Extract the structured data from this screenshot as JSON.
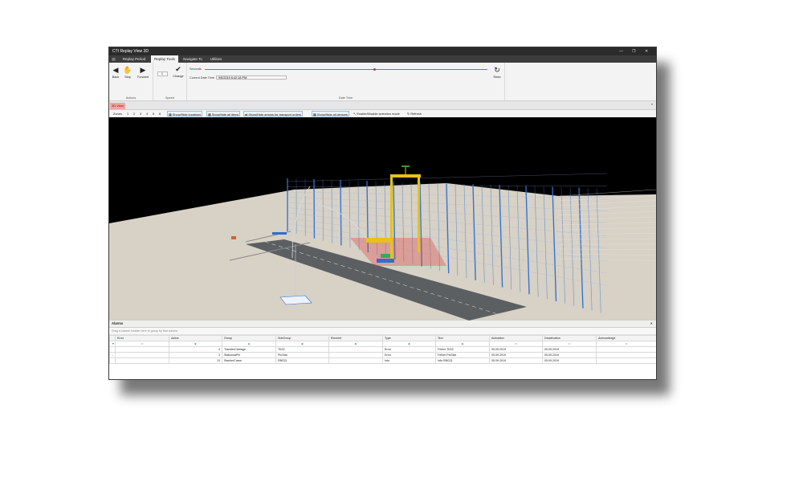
{
  "window": {
    "title": "CTI Replay View 3D",
    "controls": [
      "—",
      "❐",
      "✕"
    ]
  },
  "ribbon_tabs": [
    "Replay Period",
    "Replay Tools",
    "Navigate To",
    "Utilities"
  ],
  "actions": {
    "back": "Back",
    "stop": "Stop",
    "forward": "Forward",
    "group": "Actions"
  },
  "speed": {
    "value": "1",
    "change": "Change",
    "group": "Speed"
  },
  "datetime": {
    "seconds_label": "Seconds",
    "current_label": "Current Date Time",
    "current_value": "9/5/2019 6:42:18 PM",
    "redo": "Redo",
    "group": "Date Time",
    "progress": 0.6
  },
  "view_tab": "3D View",
  "toolbar": {
    "zones_label": "Zones",
    "zones": [
      "1",
      "2",
      "3",
      "4",
      "5",
      "6"
    ],
    "buttons": [
      "Show/Hide locations",
      "Show/hide all items",
      "Show/Hide arrows for transport orders",
      "Show/Hide all devices",
      "Enable/Disable selection mode",
      "Refresh"
    ]
  },
  "alarms": {
    "title": "Alarms",
    "drag_hint": "Drag a column header here to group by that column",
    "columns": [
      "Error",
      "Active",
      "Group",
      "SubGroup",
      "Element",
      "Type",
      "Text",
      "Activation",
      "Deactivation",
      "Acknowledge"
    ],
    "rows": [
      {
        "active": "4",
        "group": "TransferCarriage",
        "subgroup": "TbS2",
        "element": "",
        "type": "Error",
        "text": "Fehler TbS2",
        "activation": "05.09.2019",
        "deactivation": "05.09.2019",
        "ack": ""
      },
      {
        "active": "3",
        "group": "StationsaPfc",
        "subgroup": "PtcStat",
        "element": "",
        "type": "Error",
        "text": "Fehler PtcStat",
        "activation": "05.09.2019",
        "deactivation": "05.09.2019",
        "ack": ""
      },
      {
        "active": "13",
        "group": "StackerCrane",
        "subgroup": "RBG21",
        "element": "",
        "type": "Info",
        "text": "Info RBG21",
        "activation": "05.09.2019",
        "deactivation": "05.09.2019",
        "ack": ""
      }
    ]
  },
  "colors": {
    "rack": "#2f6fd0",
    "crane": "#e6c21a",
    "floor": "#d7d1c6",
    "road": "#5b5f62",
    "viewport_bg": "#000000"
  }
}
